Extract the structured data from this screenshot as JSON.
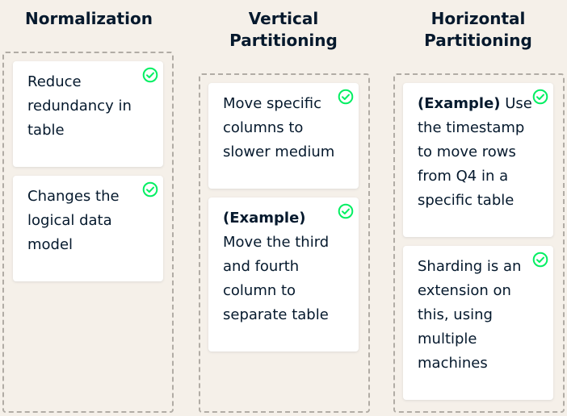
{
  "colors": {
    "background": "#f5f0e9",
    "text": "#05192d",
    "dashed_border": "#b1aca5",
    "card": "#ffffff",
    "check": "#03ef62"
  },
  "columns": [
    {
      "title": "Normalization",
      "cards": [
        {
          "lead": "",
          "text": "Reduce\nredundancy in\ntable",
          "icon": "check-circle-icon"
        },
        {
          "lead": "",
          "text": "Changes the\nlogical data\nmodel",
          "icon": "check-circle-icon"
        }
      ]
    },
    {
      "title": "Vertical\nPartitioning",
      "cards": [
        {
          "lead": "",
          "text": "Move specific\ncolumns to\nslower medium",
          "icon": "check-circle-icon"
        },
        {
          "lead": "(Example)",
          "text": "\nMove the third\nand fourth\ncolumn to\nseparate table",
          "icon": "check-circle-icon"
        }
      ]
    },
    {
      "title": "Horizontal\nPartitioning",
      "cards": [
        {
          "lead": "(Example)",
          "text": " Use\nthe timestamp\nto move rows\nfrom Q4 in a\nspecific table",
          "icon": "check-circle-icon"
        },
        {
          "lead": "",
          "text": "Sharding is an\nextension on\nthis, using\nmultiple\nmachines",
          "icon": "check-circle-icon"
        }
      ]
    }
  ]
}
